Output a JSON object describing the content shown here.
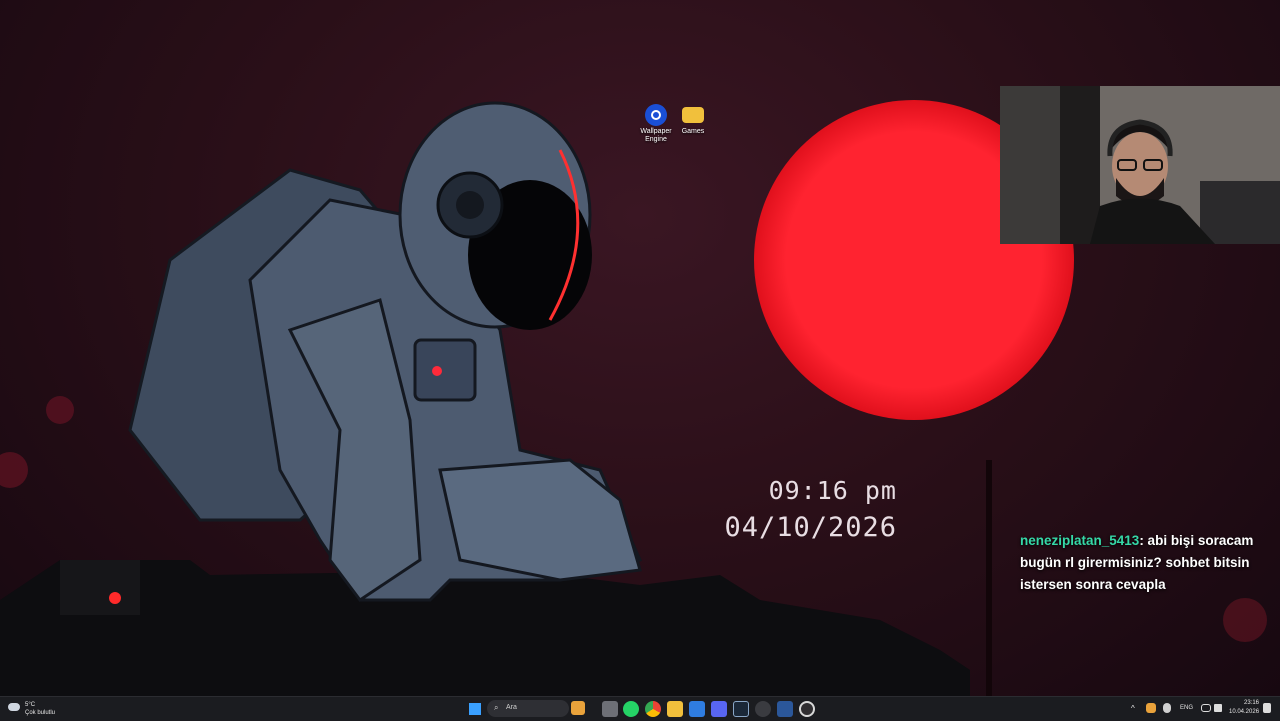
{
  "desktop": {
    "icons": [
      {
        "label_line1": "Wallpaper",
        "label_line2": "Engine"
      },
      {
        "label_line1": "Games",
        "label_line2": ""
      }
    ]
  },
  "clock_widget": {
    "time": "09:16 pm",
    "date": "04/10/2026"
  },
  "chat": {
    "username": "neneziplatan_5413",
    "message": ": abi bişi soracam bugün rl girermisiniz? sohbet bitsin istersen sonra cevapla"
  },
  "taskbar": {
    "weather_temp": "5°C",
    "weather_desc": "Çok bulutlu",
    "search_placeholder": "Ara",
    "language": "ENG",
    "time": "23:16",
    "date": "10.04.2026"
  },
  "colors": {
    "sun": "#ff1a25",
    "chat_username": "#35d8a7",
    "taskbar_bg": "#1b1c20"
  }
}
